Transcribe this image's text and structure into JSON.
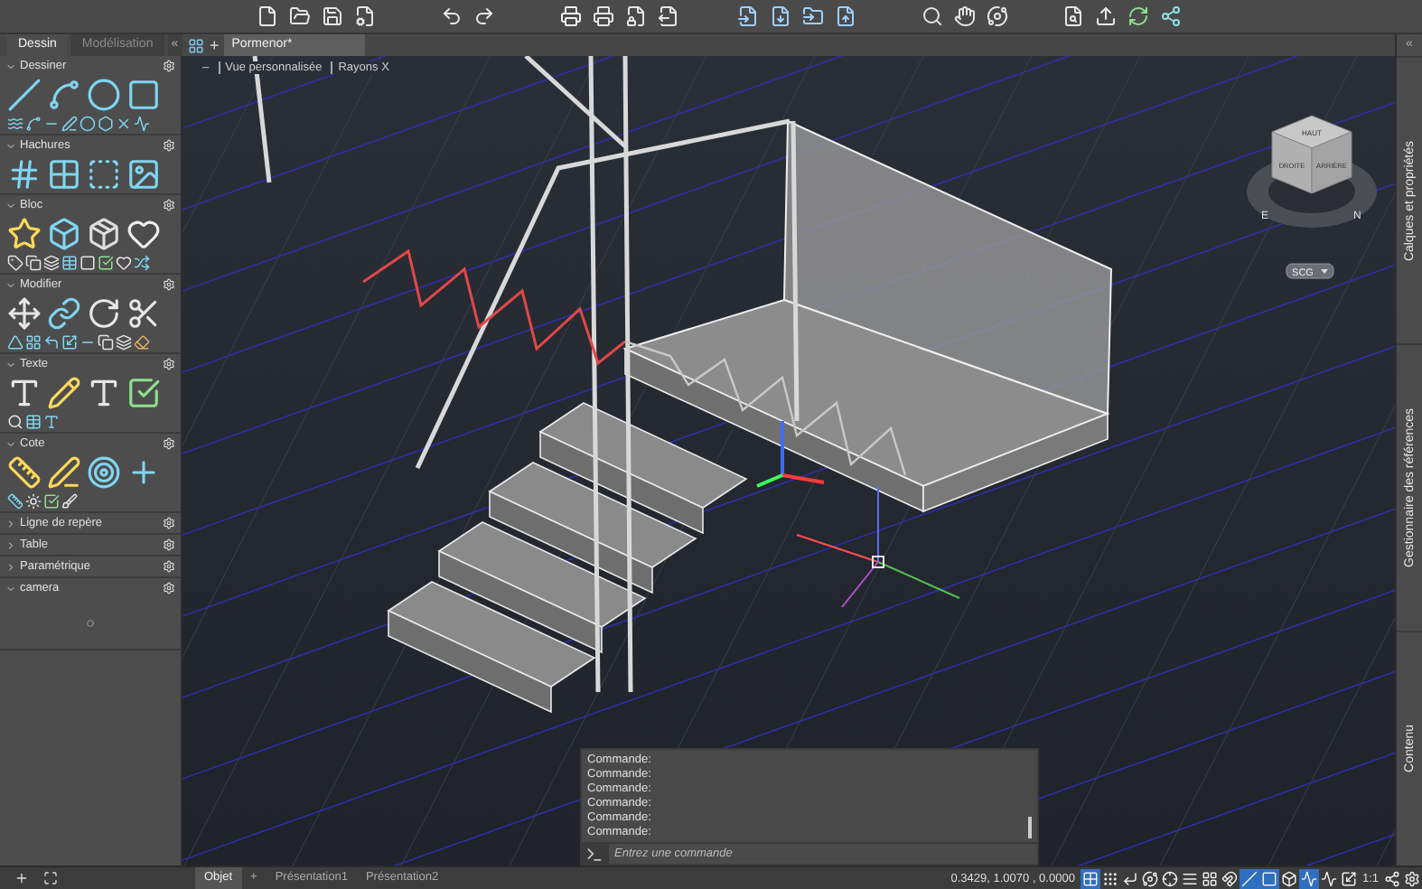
{
  "panel_tabs": [
    {
      "label": "Dessin",
      "selected": true
    },
    {
      "label": "Modélisation",
      "selected": false
    }
  ],
  "panel_collapse": "«",
  "sections": [
    {
      "title": "Dessiner",
      "expanded": true
    },
    {
      "title": "Hachures",
      "expanded": true
    },
    {
      "title": "Bloc",
      "expanded": true
    },
    {
      "title": "Modifier",
      "expanded": true
    },
    {
      "title": "Texte",
      "expanded": true
    },
    {
      "title": "Cote",
      "expanded": true
    },
    {
      "title": "Ligne de repère",
      "expanded": false
    },
    {
      "title": "Table",
      "expanded": false
    },
    {
      "title": "Paramétrique",
      "expanded": false
    },
    {
      "title": "camera",
      "expanded": true
    }
  ],
  "document_tabs": [
    {
      "label": "Pormenor*",
      "selected": true
    }
  ],
  "new_tab": "+",
  "right_collapse": "«",
  "view_controls": [
    "–",
    "Vue personnalisée",
    "Rayons X"
  ],
  "viewcube": {
    "top": "HAUT",
    "left": "DROITE",
    "right": "ARRIÈRE",
    "compass": [
      "E",
      "N"
    ],
    "ucs": "SCG"
  },
  "side_panels": [
    "Calques et propriétés",
    "Gestionnaire des références",
    "Contenu"
  ],
  "command": {
    "history": [
      "Commande:",
      "Commande:",
      "Commande:",
      "Commande:",
      "Commande:",
      "Commande:"
    ],
    "placeholder": "Entrez une commande"
  },
  "layout_tabs": [
    {
      "label": "Objet",
      "selected": true
    },
    {
      "label": "Présentation1",
      "selected": false
    },
    {
      "label": "Présentation2",
      "selected": false
    }
  ],
  "add_layout": "+",
  "coordinates": "0.3429, 1.0070 , 0.0000",
  "status_toggles": [
    {
      "on": true
    },
    {
      "on": false
    },
    {
      "on": false
    },
    {
      "on": false
    },
    {
      "on": false
    },
    {
      "on": false
    },
    {
      "on": false
    },
    {
      "on": false
    },
    {
      "on": true
    },
    {
      "on": true
    },
    {
      "on": false
    },
    {
      "on": true
    },
    {
      "on": false
    },
    {
      "on": false
    }
  ],
  "scale": "1:1"
}
